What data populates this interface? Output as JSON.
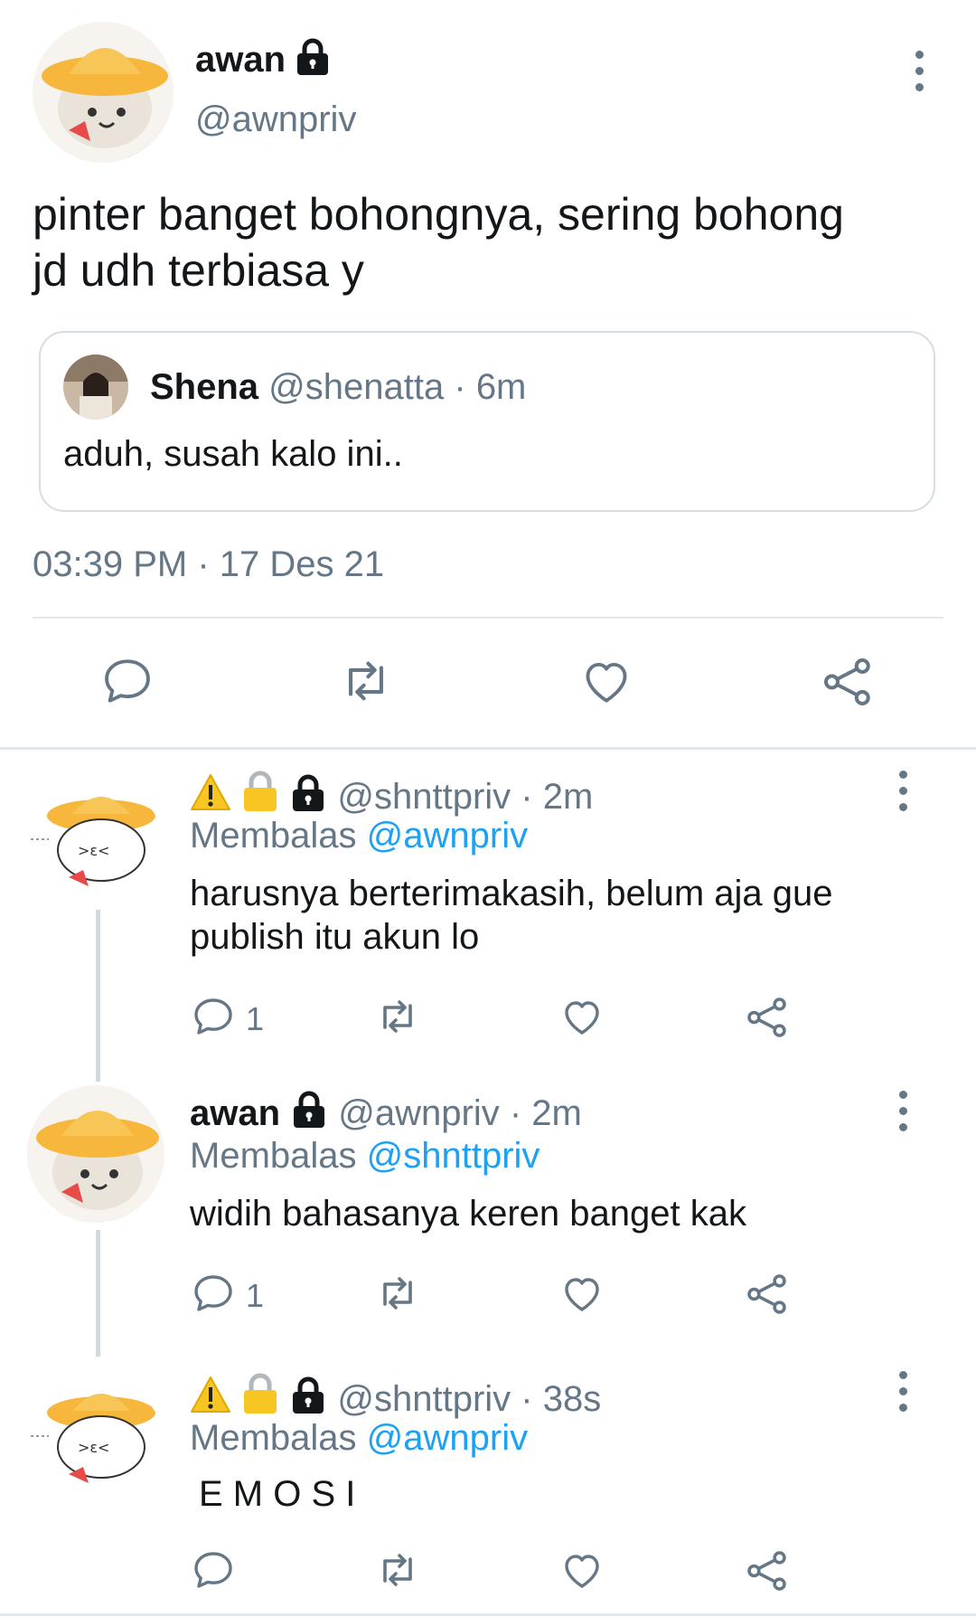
{
  "main_tweet": {
    "name": "awan",
    "handle": "@awnpriv",
    "text_line1": "pinter banget bohongnya, sering bohong",
    "text_line2": "jd udh terbiasa y",
    "quote": {
      "name": "Shena",
      "handle": "@shenatta",
      "time": "6m",
      "text": "aduh, susah kalo ini.."
    },
    "timestamp": "03:39 PM · 17 Des 21"
  },
  "replies": [
    {
      "handle": "@shnttpriv",
      "time": "· 2m",
      "replying_label": "Membalas",
      "replying_to": "@awnpriv",
      "text_line1": "harusnya berterimakasih, belum aja gue",
      "text_line2": "publish itu akun lo",
      "reply_count": "1"
    },
    {
      "name": "awan",
      "handle": "@awnpriv",
      "time": "· 2m",
      "replying_label": "Membalas",
      "replying_to": "@shnttpriv",
      "text_line1": "widih bahasanya keren banget kak",
      "reply_count": "1"
    },
    {
      "handle": "@shnttpriv",
      "time": "· 38s",
      "replying_label": "Membalas",
      "replying_to": "@awnpriv",
      "text_line1": "E M O S I"
    }
  ],
  "colors": {
    "accent": "#1da1f2",
    "muted": "#657786",
    "divider": "#e1e8ed"
  },
  "icons": [
    "reply-icon",
    "retweet-icon",
    "like-icon",
    "share-icon",
    "more-icon",
    "lock-icon",
    "warning-icon"
  ]
}
